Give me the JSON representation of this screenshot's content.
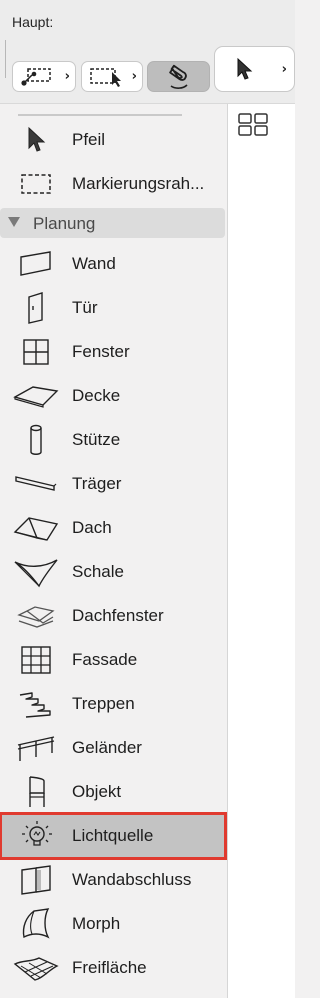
{
  "header": {
    "title": "Haupt:",
    "buttons": [
      {
        "name": "marquee-dot-tool",
        "chevron": "›"
      },
      {
        "name": "marquee-arrow-tool",
        "chevron": "›"
      },
      {
        "name": "magnet-snap-tool"
      },
      {
        "name": "pointer-tool",
        "chevron": "›"
      }
    ]
  },
  "tools": {
    "pfeil": "Pfeil",
    "markierungsrahmen": "Markierungsrah...",
    "section": "Planung",
    "items": [
      "Wand",
      "Tür",
      "Fenster",
      "Decke",
      "Stütze",
      "Träger",
      "Dach",
      "Schale",
      "Dachfenster",
      "Fassade",
      "Treppen",
      "Geländer",
      "Objekt",
      "Lichtquelle",
      "Wandabschluss",
      "Morph",
      "Freifläche"
    ],
    "selected": "Lichtquelle"
  },
  "colors": {
    "selection_outline": "#e03a2f",
    "selected_bg": "#c3c3c3",
    "section_bg": "#dcdcdc"
  }
}
